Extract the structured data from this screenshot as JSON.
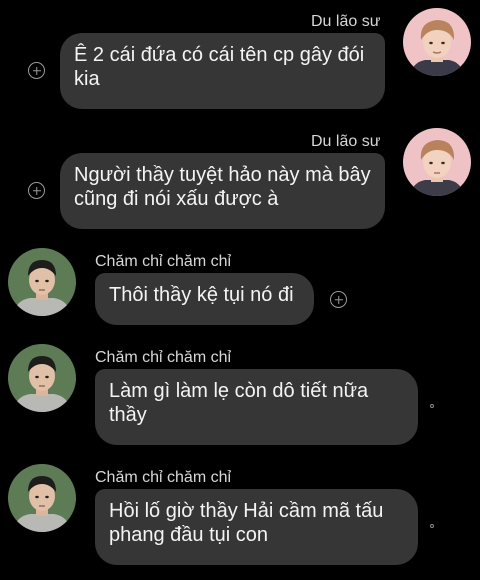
{
  "colors": {
    "background": "#000000",
    "bubble": "#363636",
    "text": "#f4f4f4",
    "name": "#d7d7d7",
    "icon": "#9b9b9b"
  },
  "messages": [
    {
      "sender": "Du lão sư",
      "side": "right",
      "text": "Ê 2 cái đứa có cái tên cp gây đói kia",
      "action_icon": "add-reaction-icon"
    },
    {
      "sender": "Du lão sư",
      "side": "right",
      "text": "Người thầy tuyệt hảo này mà bây cũng đi nói xấu được à",
      "action_icon": "add-reaction-icon"
    },
    {
      "sender": "Chăm chỉ chăm chỉ",
      "side": "left",
      "text": "Thôi thầy kệ tụi nó đi",
      "action_icon": "add-reaction-icon"
    },
    {
      "sender": "Chăm chỉ chăm chỉ",
      "side": "left",
      "text": "Làm gì làm lẹ còn dô tiết nữa thầy",
      "action_icon": "read-receipt-dot-icon"
    },
    {
      "sender": "Chăm chỉ chăm chỉ",
      "side": "left",
      "text": "Hồi lố giờ thầy Hải cầm mã tấu phang đầu tụi con",
      "action_icon": "read-receipt-dot-icon"
    }
  ]
}
